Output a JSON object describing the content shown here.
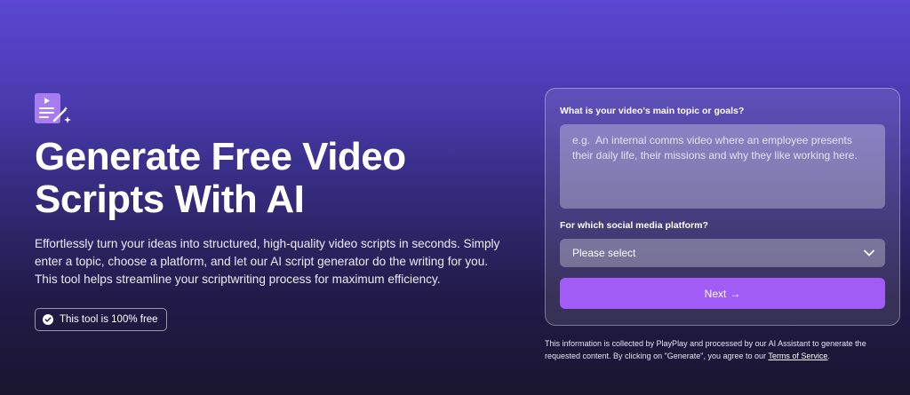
{
  "hero": {
    "icon": "script-document-sparkle-icon",
    "title": "Generate Free Video Scripts With AI",
    "description": "Effortlessly turn your ideas into structured, high-quality video scripts in seconds. Simply enter a topic, choose a platform, and let our AI script generator do the writing for you. This tool helps streamline your scriptwriting process for maximum efficiency.",
    "badge": {
      "icon": "check-circle-icon",
      "label": "This tool is 100% free"
    }
  },
  "form": {
    "topic_label": "What is your video's main topic or goals?",
    "topic_value": "",
    "topic_placeholder": "e.g.  An internal comms video where an employee presents their daily life, their missions and why they like working here.",
    "platform_label": "For which social media platform?",
    "platform_selected": "Please select",
    "platform_icon": "chevron-down-icon",
    "next_label": "Next",
    "next_arrow": "→"
  },
  "disclaimer": {
    "text": "This information is collected by PlayPlay and processed by our AI Assistant to generate the requested content. By clicking on \"Generate\", you agree to our ",
    "link": "Terms of Service",
    "end": "."
  },
  "colors": {
    "accent": "#a15cf5",
    "icon_purple": "#a77cf0",
    "bg_top": "#5b47d3",
    "bg_bottom": "#1a1530"
  }
}
